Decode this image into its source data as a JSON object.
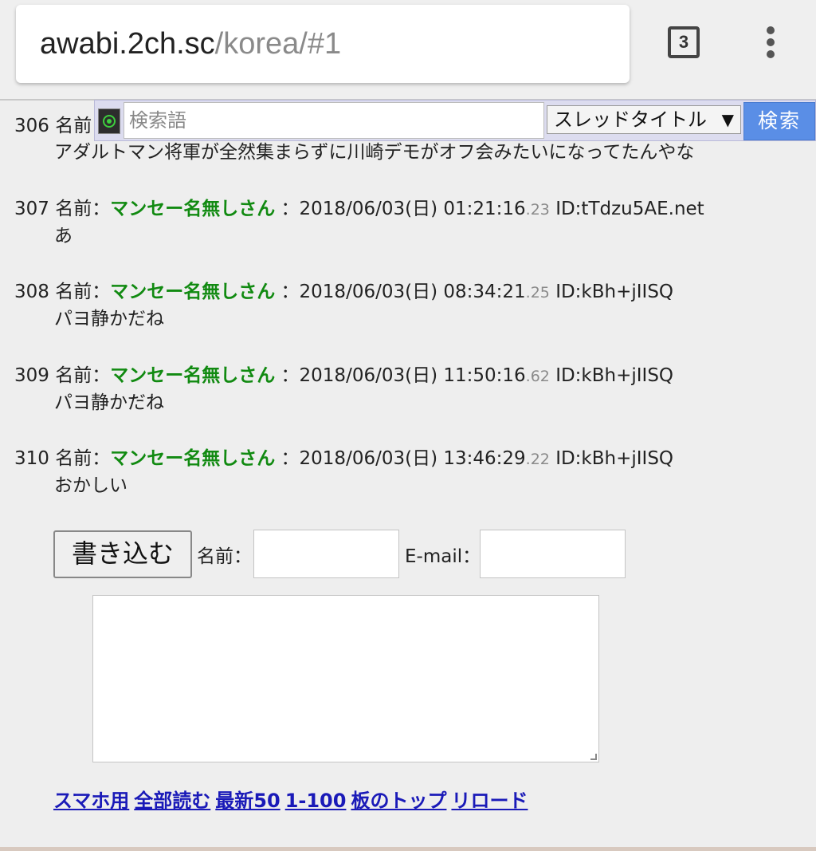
{
  "browser": {
    "url_host": "awabi.2ch.sc",
    "url_path": "/korea/#1",
    "tab_count": "3",
    "menu_icon": "vertical-dots-icon"
  },
  "search": {
    "logo_icon": "green-circle-logo-icon",
    "placeholder": "検索語",
    "select_value": "スレッドタイトル",
    "select_arrow": "▼",
    "button_label": "検索"
  },
  "posts": [
    {
      "number": "306",
      "name_label": "名前",
      "body": "アダルトマン将軍が全然集まらずに川崎デモがオフ会みたいになってたんやな"
    },
    {
      "number": "307",
      "name_label": "名前：",
      "name": "マンセー名無しさん",
      "sep": "：",
      "datetime": "2018/06/03(日) 01:21:16",
      "msec": ".23",
      "id": "ID:tTdzu5AE.net",
      "body": "あ"
    },
    {
      "number": "308",
      "name_label": "名前：",
      "name": "マンセー名無しさん",
      "sep": "：",
      "datetime": "2018/06/03(日) 08:34:21",
      "msec": ".25",
      "id": "ID:kBh+jIISQ",
      "body": "パヨ静かだね"
    },
    {
      "number": "309",
      "name_label": "名前：",
      "name": "マンセー名無しさん",
      "sep": "：",
      "datetime": "2018/06/03(日) 11:50:16",
      "msec": ".62",
      "id": "ID:kBh+jIISQ",
      "body": "パヨ静かだね"
    },
    {
      "number": "310",
      "name_label": "名前：",
      "name": "マンセー名無しさん",
      "sep": "：",
      "datetime": "2018/06/03(日) 13:46:29",
      "msec": ".22",
      "id": "ID:kBh+jIISQ",
      "body": "おかしい"
    }
  ],
  "form": {
    "submit_label": "書き込む",
    "name_label": "名前：",
    "name_value": "",
    "email_label": "E-mail：",
    "email_value": "",
    "message_value": ""
  },
  "footer_links": [
    "スマホ用",
    "全部読む",
    "最新50",
    "1-100",
    "板のトップ",
    "リロード"
  ]
}
